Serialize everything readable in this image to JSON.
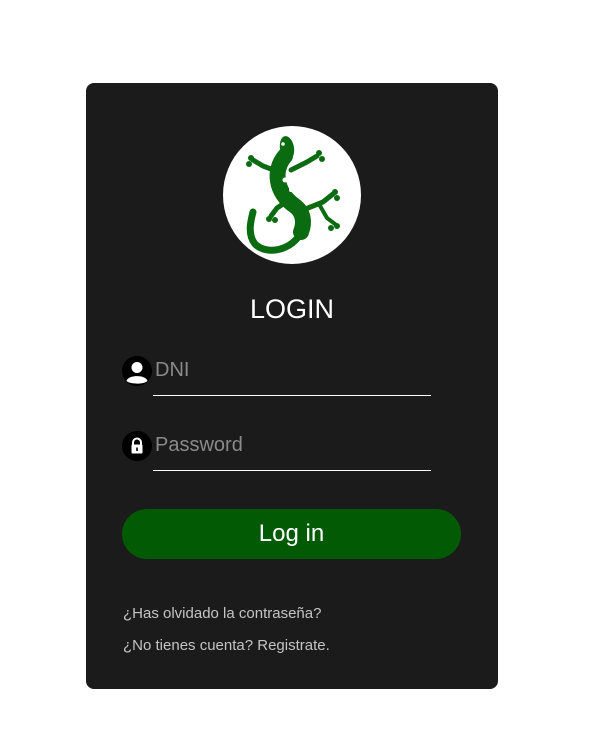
{
  "login": {
    "title": "LOGIN",
    "logo_icon": "gecko-icon",
    "fields": {
      "dni": {
        "icon": "user-icon",
        "placeholder": "DNI",
        "value": ""
      },
      "password": {
        "icon": "lock-icon",
        "placeholder": "Password",
        "value": ""
      }
    },
    "submit_label": "Log in",
    "forgot_password_link": "¿Has olvidado la contraseña?",
    "register_link": "¿No tienes cuenta? Registrate."
  },
  "colors": {
    "page_background": "#ffffff",
    "card_background": "#1b1b1b",
    "button_background": "#035a04",
    "logo_green": "#0b6b10",
    "link_text": "#c4c4c4",
    "placeholder_text": "#8a8a8a"
  }
}
